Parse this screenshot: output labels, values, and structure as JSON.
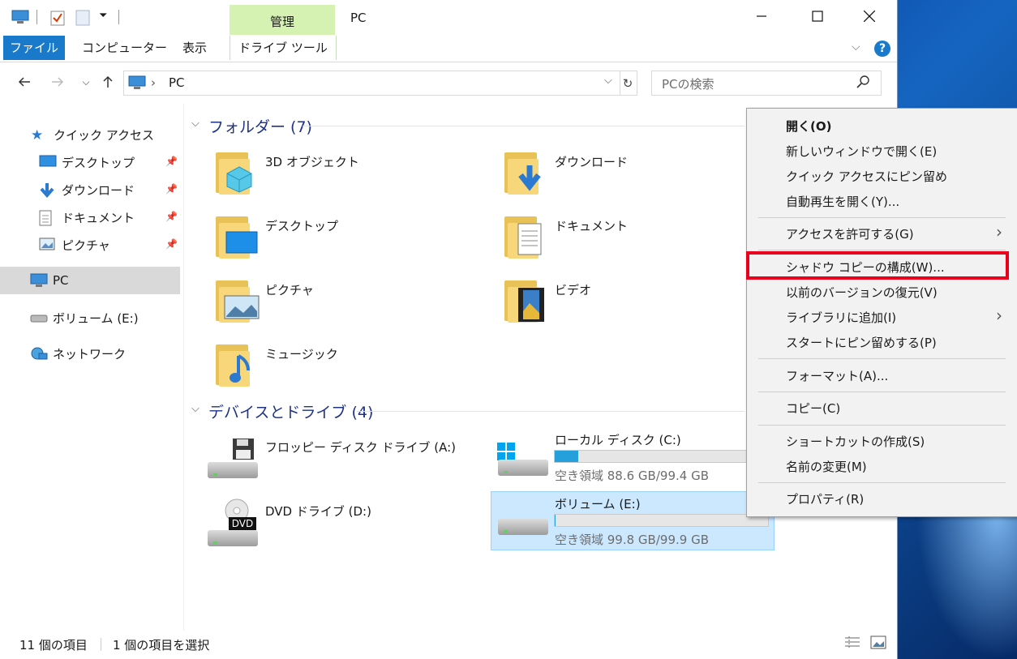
{
  "window": {
    "title": "PC",
    "manage_tab": "管理",
    "ribbon_tabs": [
      "ファイル",
      "コンピューター",
      "表示",
      "ドライブ ツール"
    ]
  },
  "address": {
    "path": "PC",
    "search_placeholder": "PCの検索"
  },
  "nav": {
    "quick_access": "クイック アクセス",
    "items": [
      "デスクトップ",
      "ダウンロード",
      "ドキュメント",
      "ピクチャ"
    ],
    "pc": "PC",
    "volume": "ボリューム (E:)",
    "network": "ネットワーク"
  },
  "folders": {
    "header": "フォルダー (7)",
    "items": [
      "3D オブジェクト",
      "ダウンロード",
      "デスクトップ",
      "ドキュメント",
      "ピクチャ",
      "ビデオ",
      "ミュージック"
    ]
  },
  "drives": {
    "header": "デバイスとドライブ (4)",
    "items": [
      {
        "name": "フロッピー ディスク ドライブ (A:)"
      },
      {
        "name": "ローカル ディスク (C:)",
        "free": "空き領域 88.6 GB/99.4 GB",
        "used_fraction": 0.11
      },
      {
        "name": "DVD ドライブ (D:)",
        "badge": "DVD"
      },
      {
        "name": "ボリューム (E:)",
        "free": "空き領域 99.8 GB/99.9 GB",
        "used_fraction": 0.001
      }
    ]
  },
  "status": {
    "count": "11 個の項目",
    "selected": "1 個の項目を選択"
  },
  "context_menu": {
    "items": [
      "開く(O)",
      "新しいウィンドウで開く(E)",
      "クイック アクセスにピン留め",
      "自動再生を開く(Y)...",
      "アクセスを許可する(G)",
      "シャドウ コピーの構成(W)...",
      "以前のバージョンの復元(V)",
      "ライブラリに追加(I)",
      "スタートにピン留めする(P)",
      "フォーマット(A)...",
      "コピー(C)",
      "ショートカットの作成(S)",
      "名前の変更(M)",
      "プロパティ(R)"
    ],
    "highlighted_index": 5
  },
  "colors": {
    "accent": "#1979ca",
    "manage_tab": "#d5f2b3",
    "highlight": "#e8001c",
    "selection": "#cce8ff",
    "progress": "#26a0da"
  }
}
